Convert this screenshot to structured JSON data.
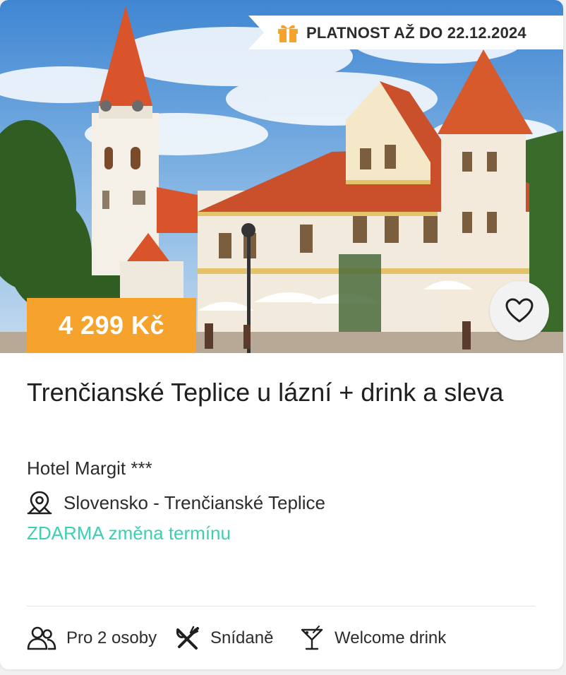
{
  "offer": {
    "validity_badge": "PLATNOST AŽ DO 22.12.2024",
    "price": "4 299 Kč",
    "title": "Trenčianské Teplice u lázní + drink a sleva",
    "hotel": "Hotel Margit ***",
    "location": "Slovensko - Trenčianské Teplice",
    "free_change": "ZDARMA změna termínu"
  },
  "features": [
    {
      "label": "Pro 2 osoby",
      "icon": "people-icon"
    },
    {
      "label": "Snídaně",
      "icon": "cutlery-icon"
    },
    {
      "label": "Welcome drink",
      "icon": "cocktail-icon"
    }
  ],
  "colors": {
    "accent_orange": "#f5a32d",
    "accent_teal": "#3ccfb2",
    "text": "#2c2c2c"
  }
}
